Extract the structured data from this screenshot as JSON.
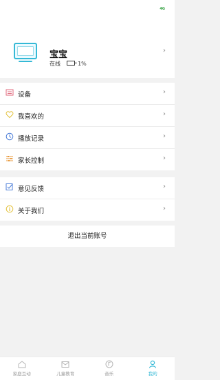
{
  "status_bar": {
    "network": "4G",
    "accent": "#2e9e3c"
  },
  "profile": {
    "name": "宝宝",
    "status": "在线",
    "battery": "1%",
    "battery_percent": 1
  },
  "menu_group_1": [
    {
      "label": "设备",
      "icon": "device-list-icon"
    },
    {
      "label": "我喜欢的",
      "icon": "heart-icon"
    },
    {
      "label": "播放记录",
      "icon": "clock-icon"
    },
    {
      "label": "家长控制",
      "icon": "sliders-icon"
    }
  ],
  "menu_group_2": [
    {
      "label": "意见反馈",
      "icon": "feedback-icon"
    },
    {
      "label": "关于我们",
      "icon": "info-icon"
    }
  ],
  "logout_label": "退出当前账号",
  "tabs": [
    {
      "label": "家庭互动",
      "icon": "home-icon",
      "active": false
    },
    {
      "label": "儿童教育",
      "icon": "mail-icon",
      "active": false
    },
    {
      "label": "音乐",
      "icon": "music-icon",
      "active": false
    },
    {
      "label": "我的",
      "icon": "user-icon",
      "active": true
    }
  ],
  "colors": {
    "accent": "#35b9d6",
    "inactive": "#9b9b9b"
  }
}
